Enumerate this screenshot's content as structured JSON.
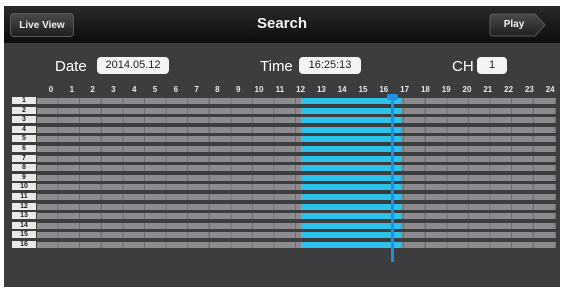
{
  "header": {
    "title": "Search",
    "back_label": "Live View",
    "play_label": "Play"
  },
  "filters": {
    "date_label": "Date",
    "date_value": "2014.05.12",
    "time_label": "Time",
    "time_value": "16:25:13",
    "ch_label": "CH",
    "ch_value": "1"
  },
  "timeline": {
    "hours": [
      "0",
      "1",
      "2",
      "3",
      "4",
      "5",
      "6",
      "7",
      "8",
      "9",
      "10",
      "11",
      "12",
      "13",
      "14",
      "15",
      "16",
      "17",
      "18",
      "19",
      "20",
      "21",
      "22",
      "23",
      "24"
    ],
    "channels": [
      "1",
      "2",
      "3",
      "4",
      "5",
      "6",
      "7",
      "8",
      "9",
      "10",
      "11",
      "12",
      "13",
      "14",
      "15",
      "16"
    ],
    "recording_start_hour": 12,
    "recording_end_hour": 16.85,
    "cursor_hour": 16.42,
    "colors": {
      "recording": "#2cc2ea",
      "cursor": "#1f8fe6",
      "track": "#8c8c90"
    }
  }
}
